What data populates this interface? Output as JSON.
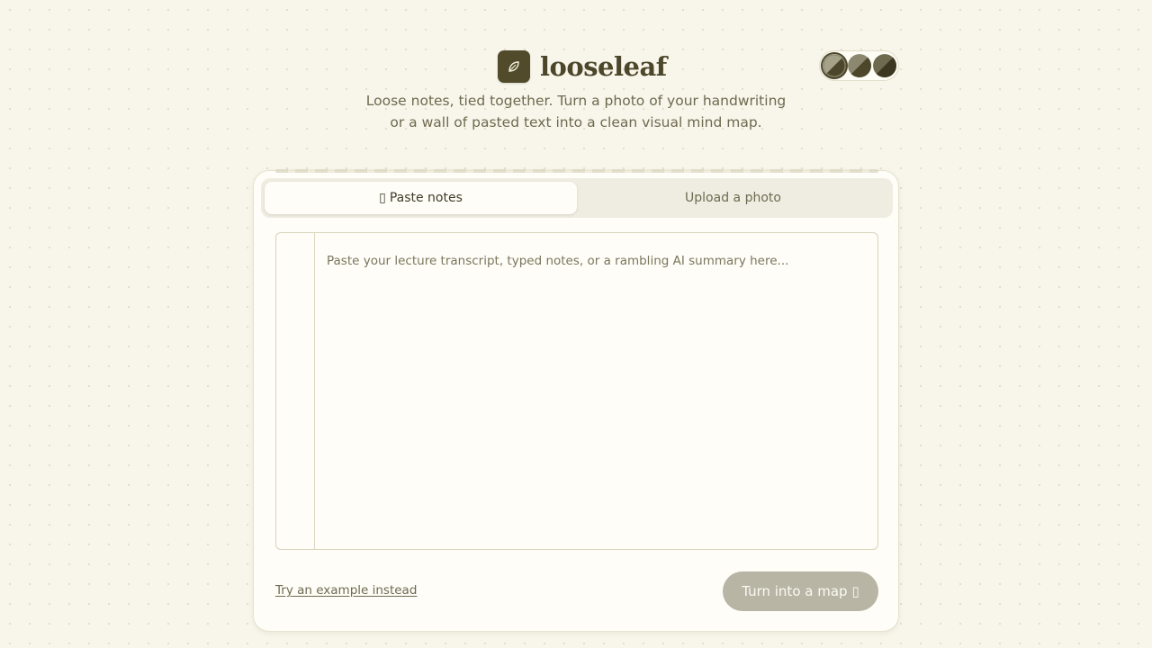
{
  "app": {
    "name": "looseleaf",
    "logo_icon": "leaf-icon",
    "tagline_line1": "Loose notes, tied together. Turn a photo of your handwriting",
    "tagline_line2": "or a wall of pasted text into a clean visual mind map."
  },
  "theme_toggle": {
    "options": [
      {
        "icon": "theme-swatch-icon",
        "active": true
      },
      {
        "icon": "theme-swatch-icon",
        "active": false
      },
      {
        "icon": "theme-swatch-icon",
        "active": false
      }
    ]
  },
  "tabs": [
    {
      "label": "Paste notes",
      "icon": "clipboard-icon",
      "glyph": "▯",
      "active": true
    },
    {
      "label": "Upload a photo",
      "active": false
    }
  ],
  "notes": {
    "value": "",
    "placeholder": "Paste your lecture transcript, typed notes, or a rambling AI summary here..."
  },
  "actions": {
    "example_link": "Try an example instead",
    "submit_label": "Turn into a map",
    "submit_glyph": "▯",
    "submit_icon": "arrow-icon"
  },
  "colors": {
    "brand": "#514b2c",
    "background": "#f8f5ea",
    "card": "#fefdf7",
    "button_disabled": "#b8b5a5"
  }
}
